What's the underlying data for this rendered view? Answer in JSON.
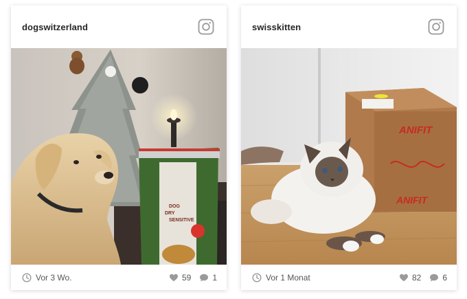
{
  "posts": [
    {
      "username": "dogswitzerland",
      "time": "Vor 3 Wo.",
      "likes": "59",
      "comments": "1",
      "bag_text": [
        "DOG",
        "DRY",
        "SENSITIVE"
      ]
    },
    {
      "username": "swisskitten",
      "time": "Vor 1 Monat",
      "likes": "82",
      "comments": "6",
      "box_text": [
        "ANIFIT",
        "ANIFIT"
      ]
    }
  ],
  "icons": {
    "header": "instagram-icon",
    "time": "clock-icon",
    "likes": "heart-icon",
    "comments": "comment-icon"
  },
  "colors": {
    "icon_gray": "#9a9a9a",
    "text": "#262626",
    "meta": "#555555"
  }
}
